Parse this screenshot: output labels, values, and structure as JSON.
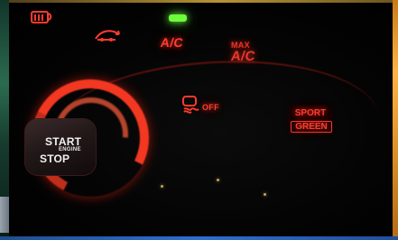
{
  "controls": {
    "ac": "A/C",
    "max_label": "MAX",
    "max_ac": "A/C",
    "off_label": "OFF",
    "sport_label": "SPORT",
    "green_label": "GREEN",
    "start_label": "START",
    "engine_label": "ENGINE",
    "stop_label": "STOP"
  },
  "icons": {
    "rear_defrost": "rear-defrost-icon",
    "recirculation": "air-recirculation-icon",
    "stability_off": "stability-control-icon",
    "indicator": "green-indicator-light"
  },
  "colors": {
    "backlight_red": "#ff3b2f",
    "indicator_green": "#6dff3a",
    "button_text": "#f2f2f2"
  }
}
